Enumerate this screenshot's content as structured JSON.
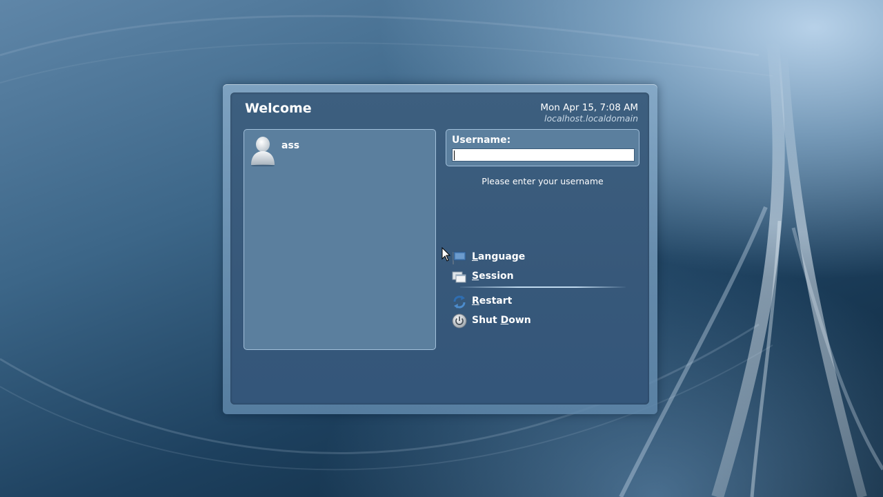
{
  "greeter": {
    "title": "Welcome",
    "datetime": "Mon Apr 15,  7:08 AM",
    "hostname": "localhost.localdomain"
  },
  "users": [
    {
      "name": "ass",
      "icon": "user-avatar-icon"
    }
  ],
  "login": {
    "label": "Username:",
    "value": "",
    "prompt": "Please enter your username"
  },
  "menu": {
    "language": {
      "mnemonic": "L",
      "rest": "anguage",
      "icon": "language-flag-icon"
    },
    "session": {
      "mnemonic": "S",
      "rest": "ession",
      "icon": "session-icon"
    },
    "restart": {
      "mnemonic": "R",
      "rest": "estart",
      "icon": "restart-icon"
    },
    "shutdown": {
      "before": "Shut ",
      "mnemonic": "D",
      "rest": "own",
      "icon": "power-icon"
    }
  },
  "colors": {
    "panel": "#37587a",
    "frame": "#87aac8",
    "userlist": "#5b7f9e",
    "text": "#ffffff",
    "hostname": "#c8d8e6"
  }
}
